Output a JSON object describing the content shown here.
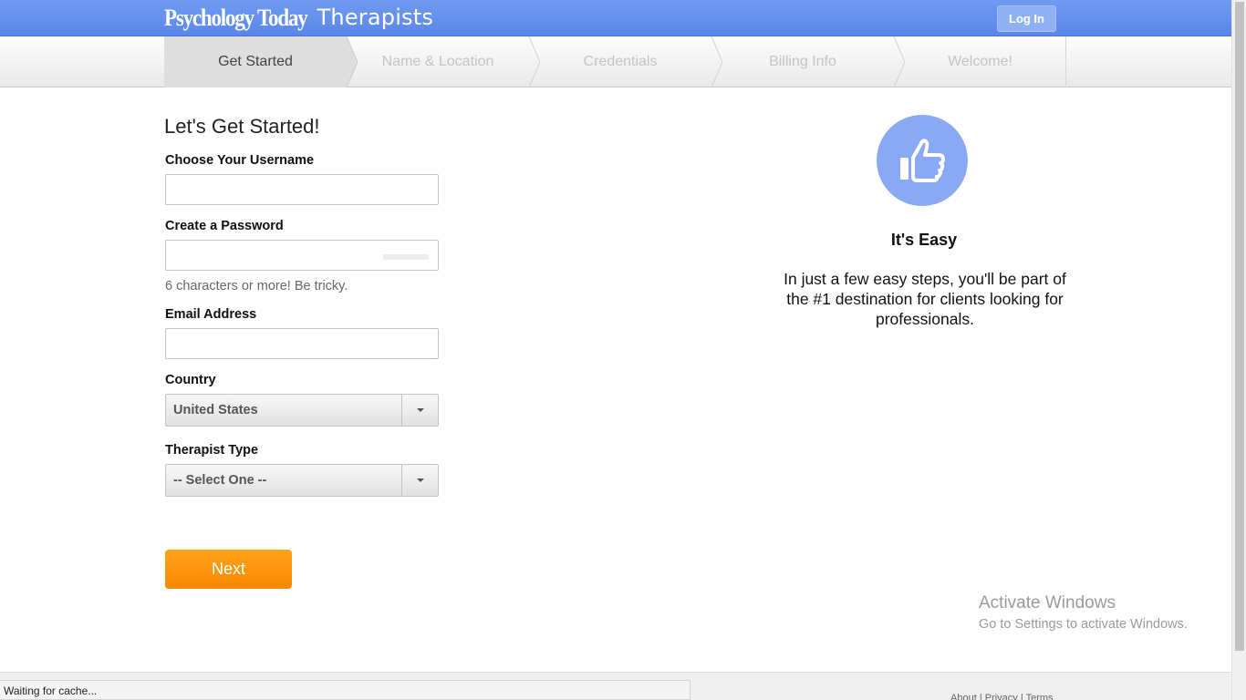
{
  "header": {
    "logo_main": "Psychology Today",
    "logo_sub": "Therapists",
    "login_label": "Log In"
  },
  "steps": [
    {
      "label": "Get Started",
      "active": true
    },
    {
      "label": "Name & Location",
      "active": false
    },
    {
      "label": "Credentials",
      "active": false
    },
    {
      "label": "Billing Info",
      "active": false
    },
    {
      "label": "Welcome!",
      "active": false
    }
  ],
  "form": {
    "heading": "Let's Get Started!",
    "username_label": "Choose Your Username",
    "username_value": "",
    "password_label": "Create a Password",
    "password_value": "",
    "password_hint": "6 characters or more! Be tricky.",
    "email_label": "Email Address",
    "email_value": "",
    "country_label": "Country",
    "country_value": "United States",
    "therapist_type_label": "Therapist Type",
    "therapist_type_value": "-- Select One --",
    "next_label": "Next"
  },
  "aside": {
    "icon": "thumbs-up-icon",
    "title": "It's Easy",
    "text": "In just a few easy steps, you'll be part of the #1 destination for clients looking for professionals."
  },
  "watermark": {
    "title": "Activate Windows",
    "subtitle": "Go to Settings to activate Windows."
  },
  "status": {
    "text": "Waiting for cache..."
  },
  "footer": {
    "links": [
      "About",
      "Privacy",
      "Terms"
    ],
    "separator": "|"
  },
  "colors": {
    "header_blue": "#5b86e8",
    "next_orange": "#fb8800",
    "circle_blue": "#8aa9f5"
  }
}
